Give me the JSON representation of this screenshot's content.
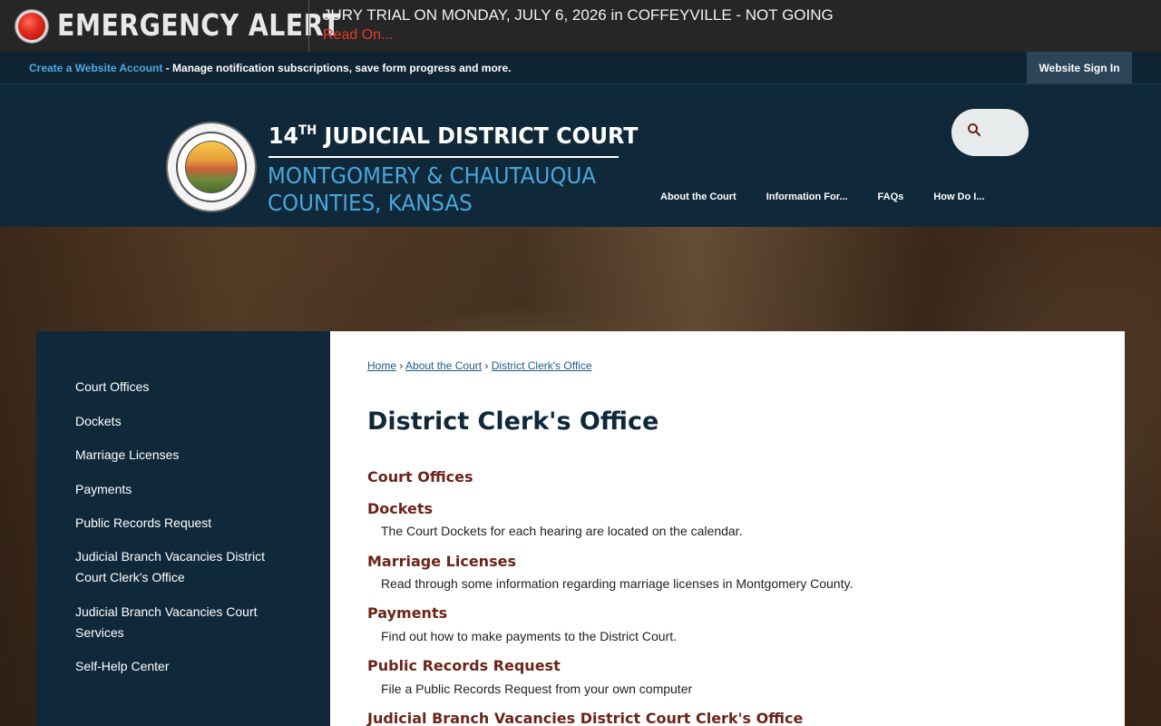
{
  "alert": {
    "title": "EMERGENCY ALERT",
    "message": "JURY TRIAL ON MONDAY, JULY 6, 2026 in COFFEYVILLE - NOT GOING",
    "link": "Read On..."
  },
  "account": {
    "create_link": "Create a Website Account",
    "create_desc": " - Manage notification subscriptions, save form progress and more.",
    "signin": "Website Sign In"
  },
  "header": {
    "title_num": "14",
    "title_sup": "TH",
    "title_rest": " JUDICIAL DISTRICT COURT",
    "subtitle_1": "MONTGOMERY & CHAUTAUQUA",
    "subtitle_2": "COUNTIES, KANSAS"
  },
  "nav": [
    "About the Court",
    "Information For...",
    "FAQs",
    "How Do I..."
  ],
  "sidebar": {
    "items": [
      "Court Offices",
      "Dockets",
      "Marriage Licenses",
      "Payments",
      "Public Records Request",
      "Judicial Branch Vacancies District Court Clerk's Office",
      "Judicial Branch Vacancies Court Services",
      "Self-Help Center"
    ]
  },
  "breadcrumb": {
    "home": "Home",
    "sep": " › ",
    "level1": "About the Court",
    "level2": "District Clerk's Office"
  },
  "page_title": "District Clerk's Office",
  "sections": [
    {
      "title": "Court Offices",
      "desc": ""
    },
    {
      "title": "Dockets",
      "desc": "The Court Dockets for each hearing are located on the calendar."
    },
    {
      "title": "Marriage Licenses",
      "desc": "Read through some information regarding marriage licenses in Montgomery County."
    },
    {
      "title": "Payments",
      "desc": "Find out how to make payments to the District Court."
    },
    {
      "title": "Public Records Request",
      "desc": "File a Public Records Request from your own computer"
    },
    {
      "title": "Judicial Branch Vacancies District Court Clerk's Office",
      "desc": ""
    }
  ],
  "colors": {
    "navy": "#10293a",
    "accent_blue": "#4aa6db",
    "alert_red": "#e8392b",
    "section_maroon": "#6b2418"
  },
  "icons": {
    "search": "search-icon",
    "alert": "alert-dot-icon",
    "seal": "kansas-seal-icon"
  }
}
